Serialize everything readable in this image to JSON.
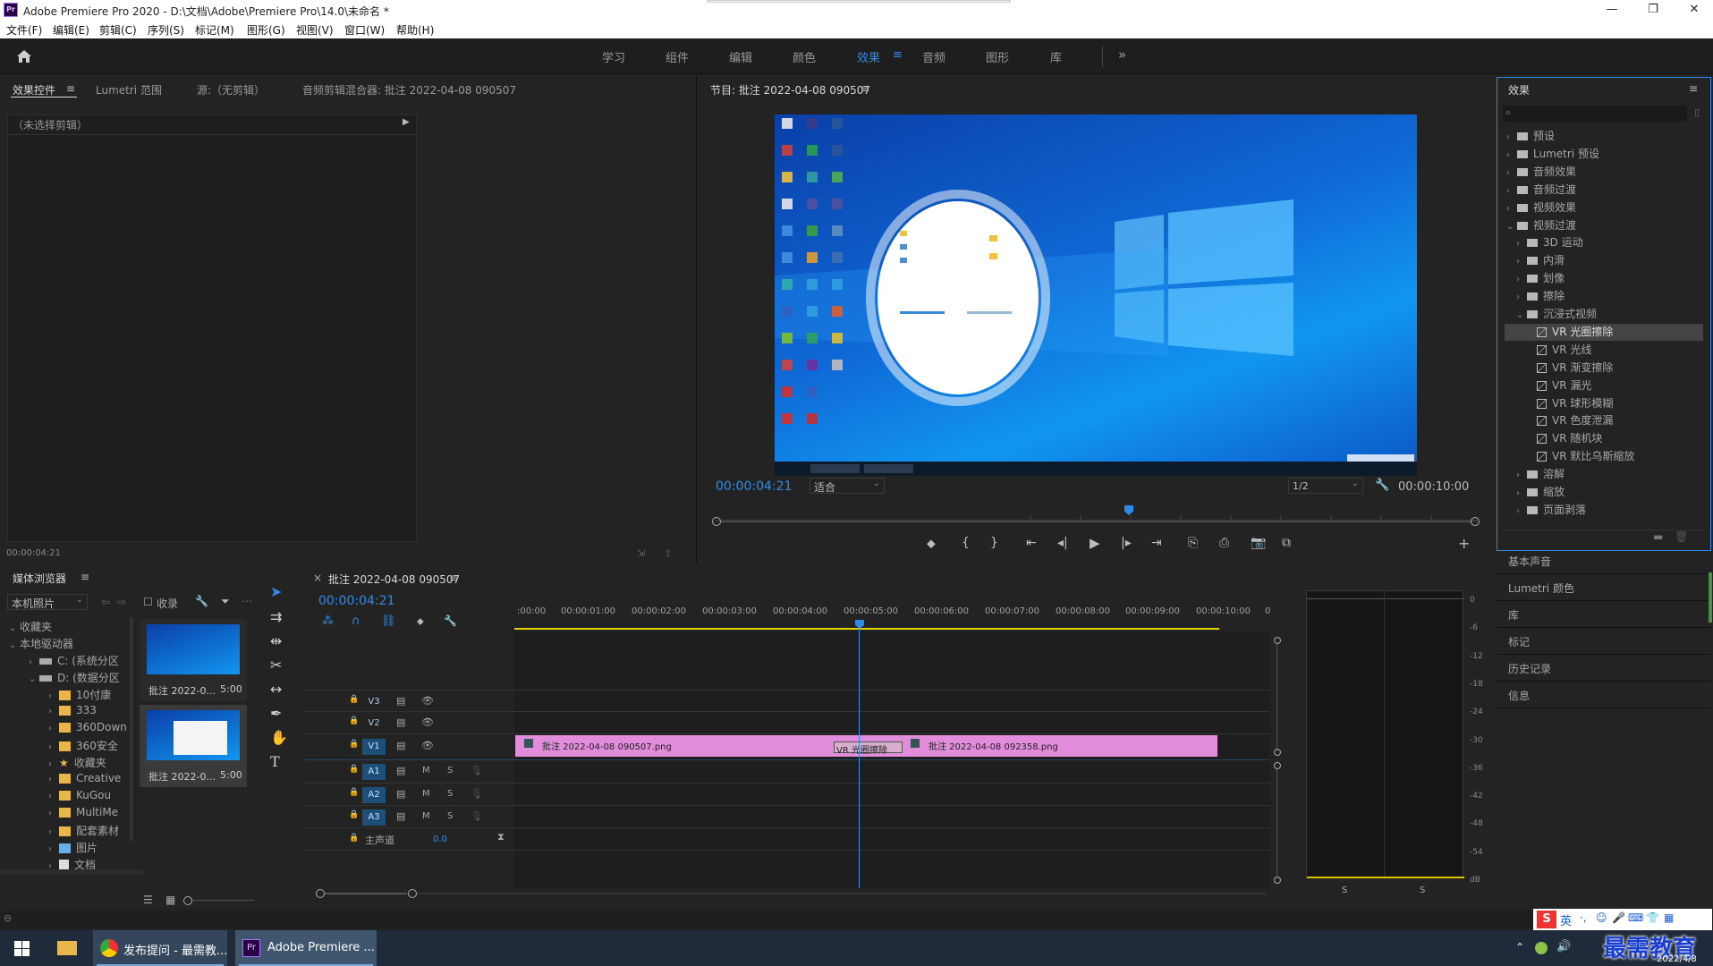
{
  "window": {
    "title": "Adobe Premiere Pro 2020 - D:\\文档\\Adobe\\Premiere Pro\\14.0\\未命名 *",
    "app_badge": "Pr",
    "minimize": "—",
    "restore": "❐",
    "close": "✕"
  },
  "menu": [
    "文件(F)",
    "编辑(E)",
    "剪辑(C)",
    "序列(S)",
    "标记(M)",
    "图形(G)",
    "视图(V)",
    "窗口(W)",
    "帮助(H)"
  ],
  "workspaces": [
    "学习",
    "组件",
    "编辑",
    "颜色",
    "效果",
    "音频",
    "图形",
    "库"
  ],
  "workspace_active": "效果",
  "workspace_more": "»",
  "source_panel": {
    "tabs": [
      "效果控件",
      "Lumetri 范围",
      "源:（无剪辑）",
      "音频剪辑混合器: 批注 2022-04-08 090507"
    ],
    "no_clip": "（未选择剪辑）",
    "timecode": "00:00:04:21"
  },
  "program_monitor": {
    "title": "节目: 批注 2022-04-08 090507",
    "timecode_current": "00:00:04:21",
    "fit": "适合",
    "resolution": "1/2",
    "timecode_total": "00:00:10:00",
    "playhead_fraction": 0.5
  },
  "effects_panel": {
    "title": "效果",
    "items": [
      {
        "label": "预设",
        "level": 0,
        "type": "folder"
      },
      {
        "label": "Lumetri 预设",
        "level": 0,
        "type": "folder"
      },
      {
        "label": "音频效果",
        "level": 0,
        "type": "folder"
      },
      {
        "label": "音频过渡",
        "level": 0,
        "type": "folder"
      },
      {
        "label": "视频效果",
        "level": 0,
        "type": "folder"
      },
      {
        "label": "视频过渡",
        "level": 0,
        "type": "folder",
        "open": true
      },
      {
        "label": "3D 运动",
        "level": 1,
        "type": "folder"
      },
      {
        "label": "内滑",
        "level": 1,
        "type": "folder"
      },
      {
        "label": "划像",
        "level": 1,
        "type": "folder"
      },
      {
        "label": "擦除",
        "level": 1,
        "type": "folder"
      },
      {
        "label": "沉浸式视频",
        "level": 1,
        "type": "folder",
        "open": true
      },
      {
        "label": "VR 光圈擦除",
        "level": 2,
        "type": "fx",
        "selected": true
      },
      {
        "label": "VR 光线",
        "level": 2,
        "type": "fx"
      },
      {
        "label": "VR 渐变擦除",
        "level": 2,
        "type": "fx"
      },
      {
        "label": "VR 漏光",
        "level": 2,
        "type": "fx"
      },
      {
        "label": "VR 球形模糊",
        "level": 2,
        "type": "fx"
      },
      {
        "label": "VR 色度泄漏",
        "level": 2,
        "type": "fx"
      },
      {
        "label": "VR 随机块",
        "level": 2,
        "type": "fx"
      },
      {
        "label": "VR 默比乌斯缩放",
        "level": 2,
        "type": "fx"
      },
      {
        "label": "溶解",
        "level": 1,
        "type": "folder"
      },
      {
        "label": "缩放",
        "level": 1,
        "type": "folder"
      },
      {
        "label": "页面剥落",
        "level": 1,
        "type": "folder"
      }
    ]
  },
  "side_panels": [
    "基本声音",
    "Lumetri 颜色",
    "库",
    "标记",
    "历史记录",
    "信息"
  ],
  "media_browser": {
    "title": "媒体浏览器",
    "location": "本机照片",
    "ingest": "收录",
    "tree": [
      {
        "label": "收藏夹",
        "level": 0
      },
      {
        "label": "本地驱动器",
        "level": 0
      },
      {
        "label": "C: (系统分区",
        "level": 1,
        "icon": "drive"
      },
      {
        "label": "D: (数据分区",
        "level": 1,
        "icon": "drive"
      },
      {
        "label": "10付康",
        "level": 2,
        "icon": "folder"
      },
      {
        "label": "333",
        "level": 2,
        "icon": "folder"
      },
      {
        "label": "360Down",
        "level": 2,
        "icon": "folder"
      },
      {
        "label": "360安全",
        "level": 2,
        "icon": "folder"
      },
      {
        "label": "收藏夹",
        "level": 2,
        "icon": "star"
      },
      {
        "label": "Creative",
        "level": 2,
        "icon": "folder"
      },
      {
        "label": "KuGou",
        "level": 2,
        "icon": "folder"
      },
      {
        "label": "MultiMe",
        "level": 2,
        "icon": "folder"
      },
      {
        "label": "配套素材",
        "level": 2,
        "icon": "folder"
      },
      {
        "label": "图片",
        "level": 2,
        "icon": "pic"
      },
      {
        "label": "文档",
        "level": 2,
        "icon": "doc"
      }
    ],
    "thumbs": [
      {
        "name": "批注 2022-0...",
        "dur": "5:00"
      },
      {
        "name": "批注 2022-0...",
        "dur": "5:00"
      }
    ]
  },
  "timeline": {
    "title": "批注 2022-04-08 090507",
    "timecode": "00:00:04:21",
    "ruler": [
      ":00:00",
      "00:00:01:00",
      "00:00:02:00",
      "00:00:03:00",
      "00:00:04:00",
      "00:00:05:00",
      "00:00:06:00",
      "00:00:07:00",
      "00:00:08:00",
      "00:00:09:00",
      "00:00:10:00",
      "0"
    ],
    "tracks": [
      "V3",
      "V2",
      "V1",
      "A1",
      "A2",
      "A3"
    ],
    "master": "主声道",
    "master_value": "0.0",
    "clip1": "批注 2022-04-08 090507.png",
    "clip2": "批注 2022-04-08 092358.png",
    "transition": "VR 光圈擦除",
    "m": "M",
    "s": "S"
  },
  "meter": {
    "labels": [
      "0",
      "-6",
      "-12",
      "-18",
      "-24",
      "-30",
      "-36",
      "-42",
      "-48",
      "-54",
      "dB"
    ],
    "solo_left": "S",
    "solo_right": "S"
  },
  "taskbar": {
    "chrome": "发布提问 - 最需教...",
    "premiere": "Adobe Premiere ...",
    "ime": "英",
    "watermark": "最需教育",
    "date": "2022/4/8"
  },
  "colors": {
    "accent": "#2d8ceb",
    "clip": "#e18ddc",
    "panel": "#232323",
    "blue_time": "#2d8ceb"
  }
}
